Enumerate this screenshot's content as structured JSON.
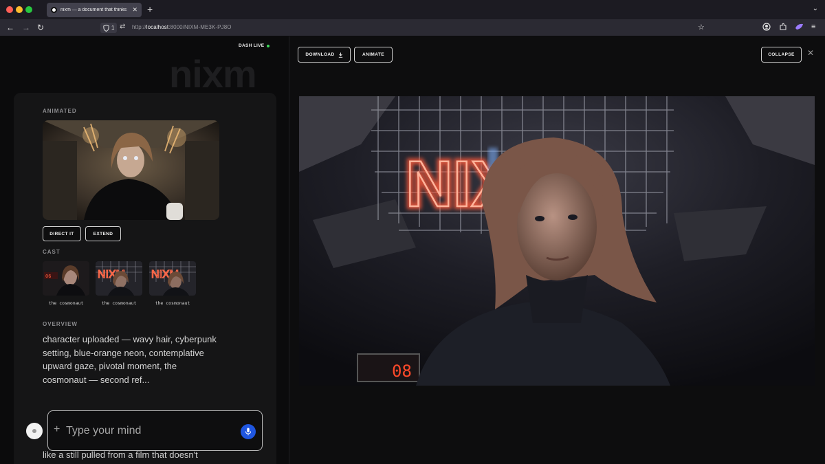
{
  "browser": {
    "tab_title": "nixm — a document that thinks",
    "tab_close": "✕",
    "new_tab": "+",
    "shield_count": "1",
    "url_prefix": "http://",
    "url_host": "localhost",
    "url_rest": ":8000/NIXM-ME3K-PJ8O"
  },
  "header": {
    "status_label": "DASH LIVE",
    "status_color": "#3ddc5a",
    "brand_logo": "nixm"
  },
  "sidebar": {
    "animated_label": "ANIMATED",
    "direct_button": "DIRECT IT",
    "extend_button": "EXTEND",
    "cast_label": "CAST",
    "cast": [
      {
        "name": "the cosmonaut"
      },
      {
        "name": "the cosmonaut"
      },
      {
        "name": "the cosmonaut"
      }
    ],
    "overview_label": "OVERVIEW",
    "overview_text": "character uploaded — wavy hair, cyberpunk setting, blue-orange neon, contemplative upward gaze, pivotal moment, the cosmonaut — second ref...",
    "overview_more": "like a still pulled from a film that doesn't"
  },
  "composer": {
    "placeholder": "Type your mind",
    "accent_color": "#1f56e0"
  },
  "viewer": {
    "download_button": "DOWNLOAD",
    "animate_button": "ANIMATE",
    "collapse_button": "COLLAPSE",
    "close_icon": "✕",
    "neon_sign_text": "NIXM",
    "counter_display": "08"
  }
}
